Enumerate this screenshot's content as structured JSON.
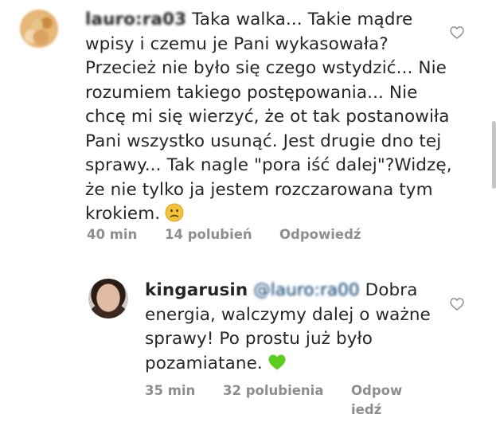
{
  "comments": [
    {
      "username": "lauro:ra03",
      "text": " Taka walka... Takie mądre wpisy i czemu je Pani wykasowała? Przecież nie było się czego wstydzić... Nie rozumiem takiego postępowania... Nie chcę mi się wierzyć, że ot tak postanowiła Pani wszystko usunąć. Jest drugie dno tej sprawy... Tak nagle \"pora iść dalej\"?Widzę, że nie tylko ja jestem rozczarowana tym krokiem.",
      "emoji": "slightly-frowning-face-emoji",
      "time": "40 min",
      "likes": "14 polubień",
      "reply": "Odpowiedź",
      "liked": false
    },
    {
      "username": "kingarusin",
      "mention": "@lauro:ra00",
      "text": " Dobra energia, walczymy dalej o ważne sprawy! Po prostu już było pozamiatane.",
      "emoji": "green-heart-emoji",
      "time": "35 min",
      "likes": "32 polubienia",
      "reply_line1": "Odpow",
      "reply_line2": "iedź",
      "liked": false
    }
  ],
  "icons": {
    "like": "heart-outline-icon",
    "scroll": "scrollbar"
  },
  "colors": {
    "text": "#262626",
    "meta": "#8e8e8e",
    "mention": "#00376b",
    "scrollbar": "#c4c4c4",
    "green_heart": "#5ccd1e",
    "emoji_face": "#f5c33b"
  }
}
